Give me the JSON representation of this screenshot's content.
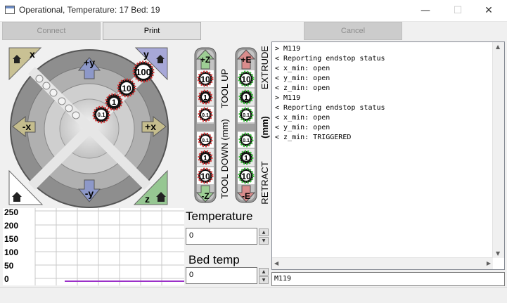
{
  "window": {
    "title": "Operational, Temperature: 17 Bed: 19",
    "minimize_glyph": "—",
    "maximize_glyph": "☐",
    "close_glyph": "✕"
  },
  "toolbar": {
    "connect_label": "Connect",
    "print_label": "Print",
    "cancel_label": "Cancel"
  },
  "xy_pad": {
    "home_x_label": "x",
    "home_y_label": "y",
    "home_z_label": "z",
    "plus_y": "+y",
    "minus_y": "-y",
    "minus_x": "-x",
    "plus_x": "+x",
    "steps": [
      "100",
      "10",
      "1",
      "0.1"
    ]
  },
  "z_column": {
    "up_label": "+Z",
    "down_label": "-Z",
    "up_steps": [
      "10",
      "1",
      "0.1"
    ],
    "down_steps": [
      "0.1",
      "1",
      "10"
    ],
    "tool_up_text": "TOOL UP",
    "tool_down_text": "TOOL DOWN (mm)"
  },
  "e_column": {
    "up_label": "+E",
    "down_label": "-E",
    "up_steps": [
      "10",
      "1",
      "0.1"
    ],
    "down_steps": [
      "0.1",
      "1",
      "10"
    ],
    "extrude_text": "EXTRUDE",
    "mm_text": "(mm)",
    "retract_text": "RETRACT"
  },
  "temperature": {
    "label": "Temperature",
    "value": "0",
    "bed_label": "Bed temp",
    "bed_value": "0",
    "spin_up": "▲",
    "spin_down": "▼"
  },
  "graph": {
    "y_ticks": [
      "250",
      "200",
      "150",
      "100",
      "50",
      "0"
    ],
    "line_color": "#9b30c8"
  },
  "console": {
    "lines": [
      "> M119",
      "< Reporting endstop status",
      "< x_min: open",
      "< y_min: open",
      "< z_min: open",
      "> M119",
      "< Reporting endstop status",
      "< x_min: open",
      "< y_min: open",
      "< z_min: TRIGGERED"
    ],
    "input_value": "M119",
    "scroll_up": "▲",
    "scroll_down": "▼",
    "scroll_left": "◀",
    "scroll_right": "▶"
  },
  "colors": {
    "home_x": "#c9c194",
    "home_y": "#a7a8d8",
    "home_z": "#96c792",
    "arrow_y": "#8d98c9",
    "arrow_x": "#c5bd8d",
    "z_up_green": "#9dce94",
    "e_up_red": "#d98c8c"
  }
}
